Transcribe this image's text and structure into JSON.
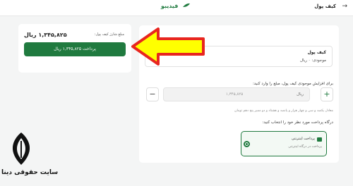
{
  "topbar": {
    "title": "کیف پول",
    "brand": "فیدیبو"
  },
  "summary": {
    "label": "مبلغ شارژ کیف پول:",
    "amount": "۱,۳۴۵,۸۲۵ ریال",
    "pay_label": "پرداخت ۱,۳۴۵,۸۲۵ ریال"
  },
  "wallet": {
    "title": "کیف پول",
    "balance": "موجودی: ۰ ریال"
  },
  "charge": {
    "prompt": "برای افزایش موجودی کیف پول، مبلغ را وارد کنید:",
    "value": "۱,۳۴۵,۸۲۵",
    "unit": "ریال",
    "plus": "+",
    "minus": "−",
    "words": "معادل یکصد و سی و چهار هزار و پانصد و هشتاد و دو ممیز پنج دهم تومان"
  },
  "gateway": {
    "prompt": "درگاه پرداخت مورد نظر خود را انتخاب کنید:",
    "title": "پرداخت اینترنتی",
    "subtitle": "پرداخت در درگاه اینترنتی"
  },
  "watermark": {
    "text": "سایت حقوقی دینا"
  },
  "colors": {
    "accent": "#207a3f",
    "arrow_fill": "#ffff00",
    "arrow_stroke": "#e8261f"
  }
}
